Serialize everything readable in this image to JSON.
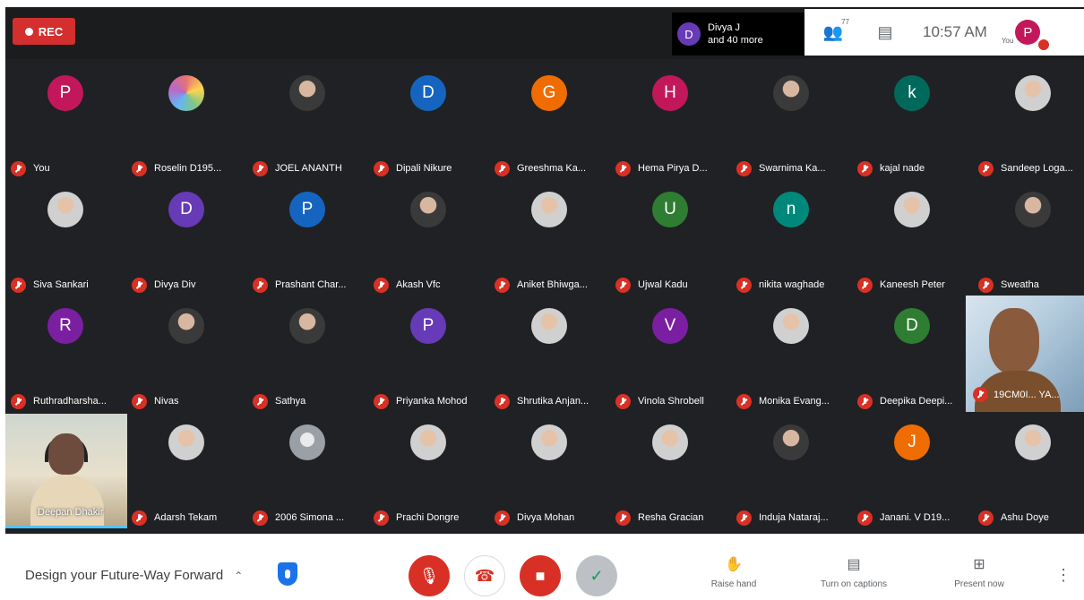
{
  "topbar": {
    "rec_label": "REC",
    "presenting": {
      "initial": "D",
      "line1": "Divya J",
      "line2": "and 40 more"
    },
    "people_count": "77",
    "time": "10:57 AM",
    "self_label": "You",
    "self_initial": "P"
  },
  "participants": [
    {
      "name": "You",
      "initial": "P",
      "color": "#c2185b"
    },
    {
      "name": "Roselin D195...",
      "photo": "color"
    },
    {
      "name": "JOEL ANANTH",
      "photo": "dark"
    },
    {
      "name": "Dipali Nikure",
      "initial": "D",
      "color": "#1565c0"
    },
    {
      "name": "Greeshma Ka...",
      "initial": "G",
      "color": "#ef6c00"
    },
    {
      "name": "Hema Pirya D...",
      "initial": "H",
      "color": "#c2185b"
    },
    {
      "name": "Swarnima Ka...",
      "photo": "dark"
    },
    {
      "name": "kajal nade",
      "initial": "k",
      "color": "#00695c"
    },
    {
      "name": "Sandeep Loga...",
      "photo": "light"
    },
    {
      "name": "Siva Sankari",
      "photo": "light"
    },
    {
      "name": "Divya Div",
      "initial": "D",
      "color": "#673ab7"
    },
    {
      "name": "Prashant Char...",
      "initial": "P",
      "color": "#1565c0"
    },
    {
      "name": "Akash Vfc",
      "photo": "dark"
    },
    {
      "name": "Aniket Bhiwga...",
      "photo": "light"
    },
    {
      "name": "Ujwal Kadu",
      "initial": "U",
      "color": "#2e7d32"
    },
    {
      "name": "nikita waghade",
      "initial": "n",
      "color": "#00897b"
    },
    {
      "name": "Kaneesh Peter",
      "photo": "light"
    },
    {
      "name": "Sweatha",
      "photo": "dark"
    },
    {
      "name": "Ruthradharsha...",
      "initial": "R",
      "color": "#7b1fa2"
    },
    {
      "name": "Nivas",
      "photo": "dark"
    },
    {
      "name": "Sathya",
      "photo": "dark"
    },
    {
      "name": "Priyanka Mohod",
      "initial": "P",
      "color": "#673ab7"
    },
    {
      "name": "Shrutika Anjan...",
      "photo": "light"
    },
    {
      "name": "Vinola Shrobell",
      "initial": "V",
      "color": "#7b1fa2"
    },
    {
      "name": "Monika Evang...",
      "photo": "light"
    },
    {
      "name": "Deepika Deepi...",
      "initial": "D",
      "color": "#2e7d32"
    },
    {
      "name": "Adarsh Tekam",
      "photo": "light"
    },
    {
      "name": "2006 Simona ...",
      "photo": "grey"
    },
    {
      "name": "Prachi Dongre",
      "photo": "light"
    },
    {
      "name": "Divya Mohan",
      "photo": "light"
    },
    {
      "name": "Resha Gracian",
      "photo": "light"
    },
    {
      "name": "Induja Nataraj...",
      "photo": "dark"
    },
    {
      "name": "Janani. V D19...",
      "initial": "J",
      "color": "#ef6c00"
    },
    {
      "name": "Ashu Doye",
      "photo": "light"
    }
  ],
  "video_tiles": {
    "self_name": "Deepan Dhakir",
    "right_name": "19CM0I... YA..."
  },
  "bottombar": {
    "meeting_title": "Design your Future-Way Forward",
    "actions": {
      "raise_hand": "Raise hand",
      "captions": "Turn on captions",
      "present": "Present now"
    }
  }
}
